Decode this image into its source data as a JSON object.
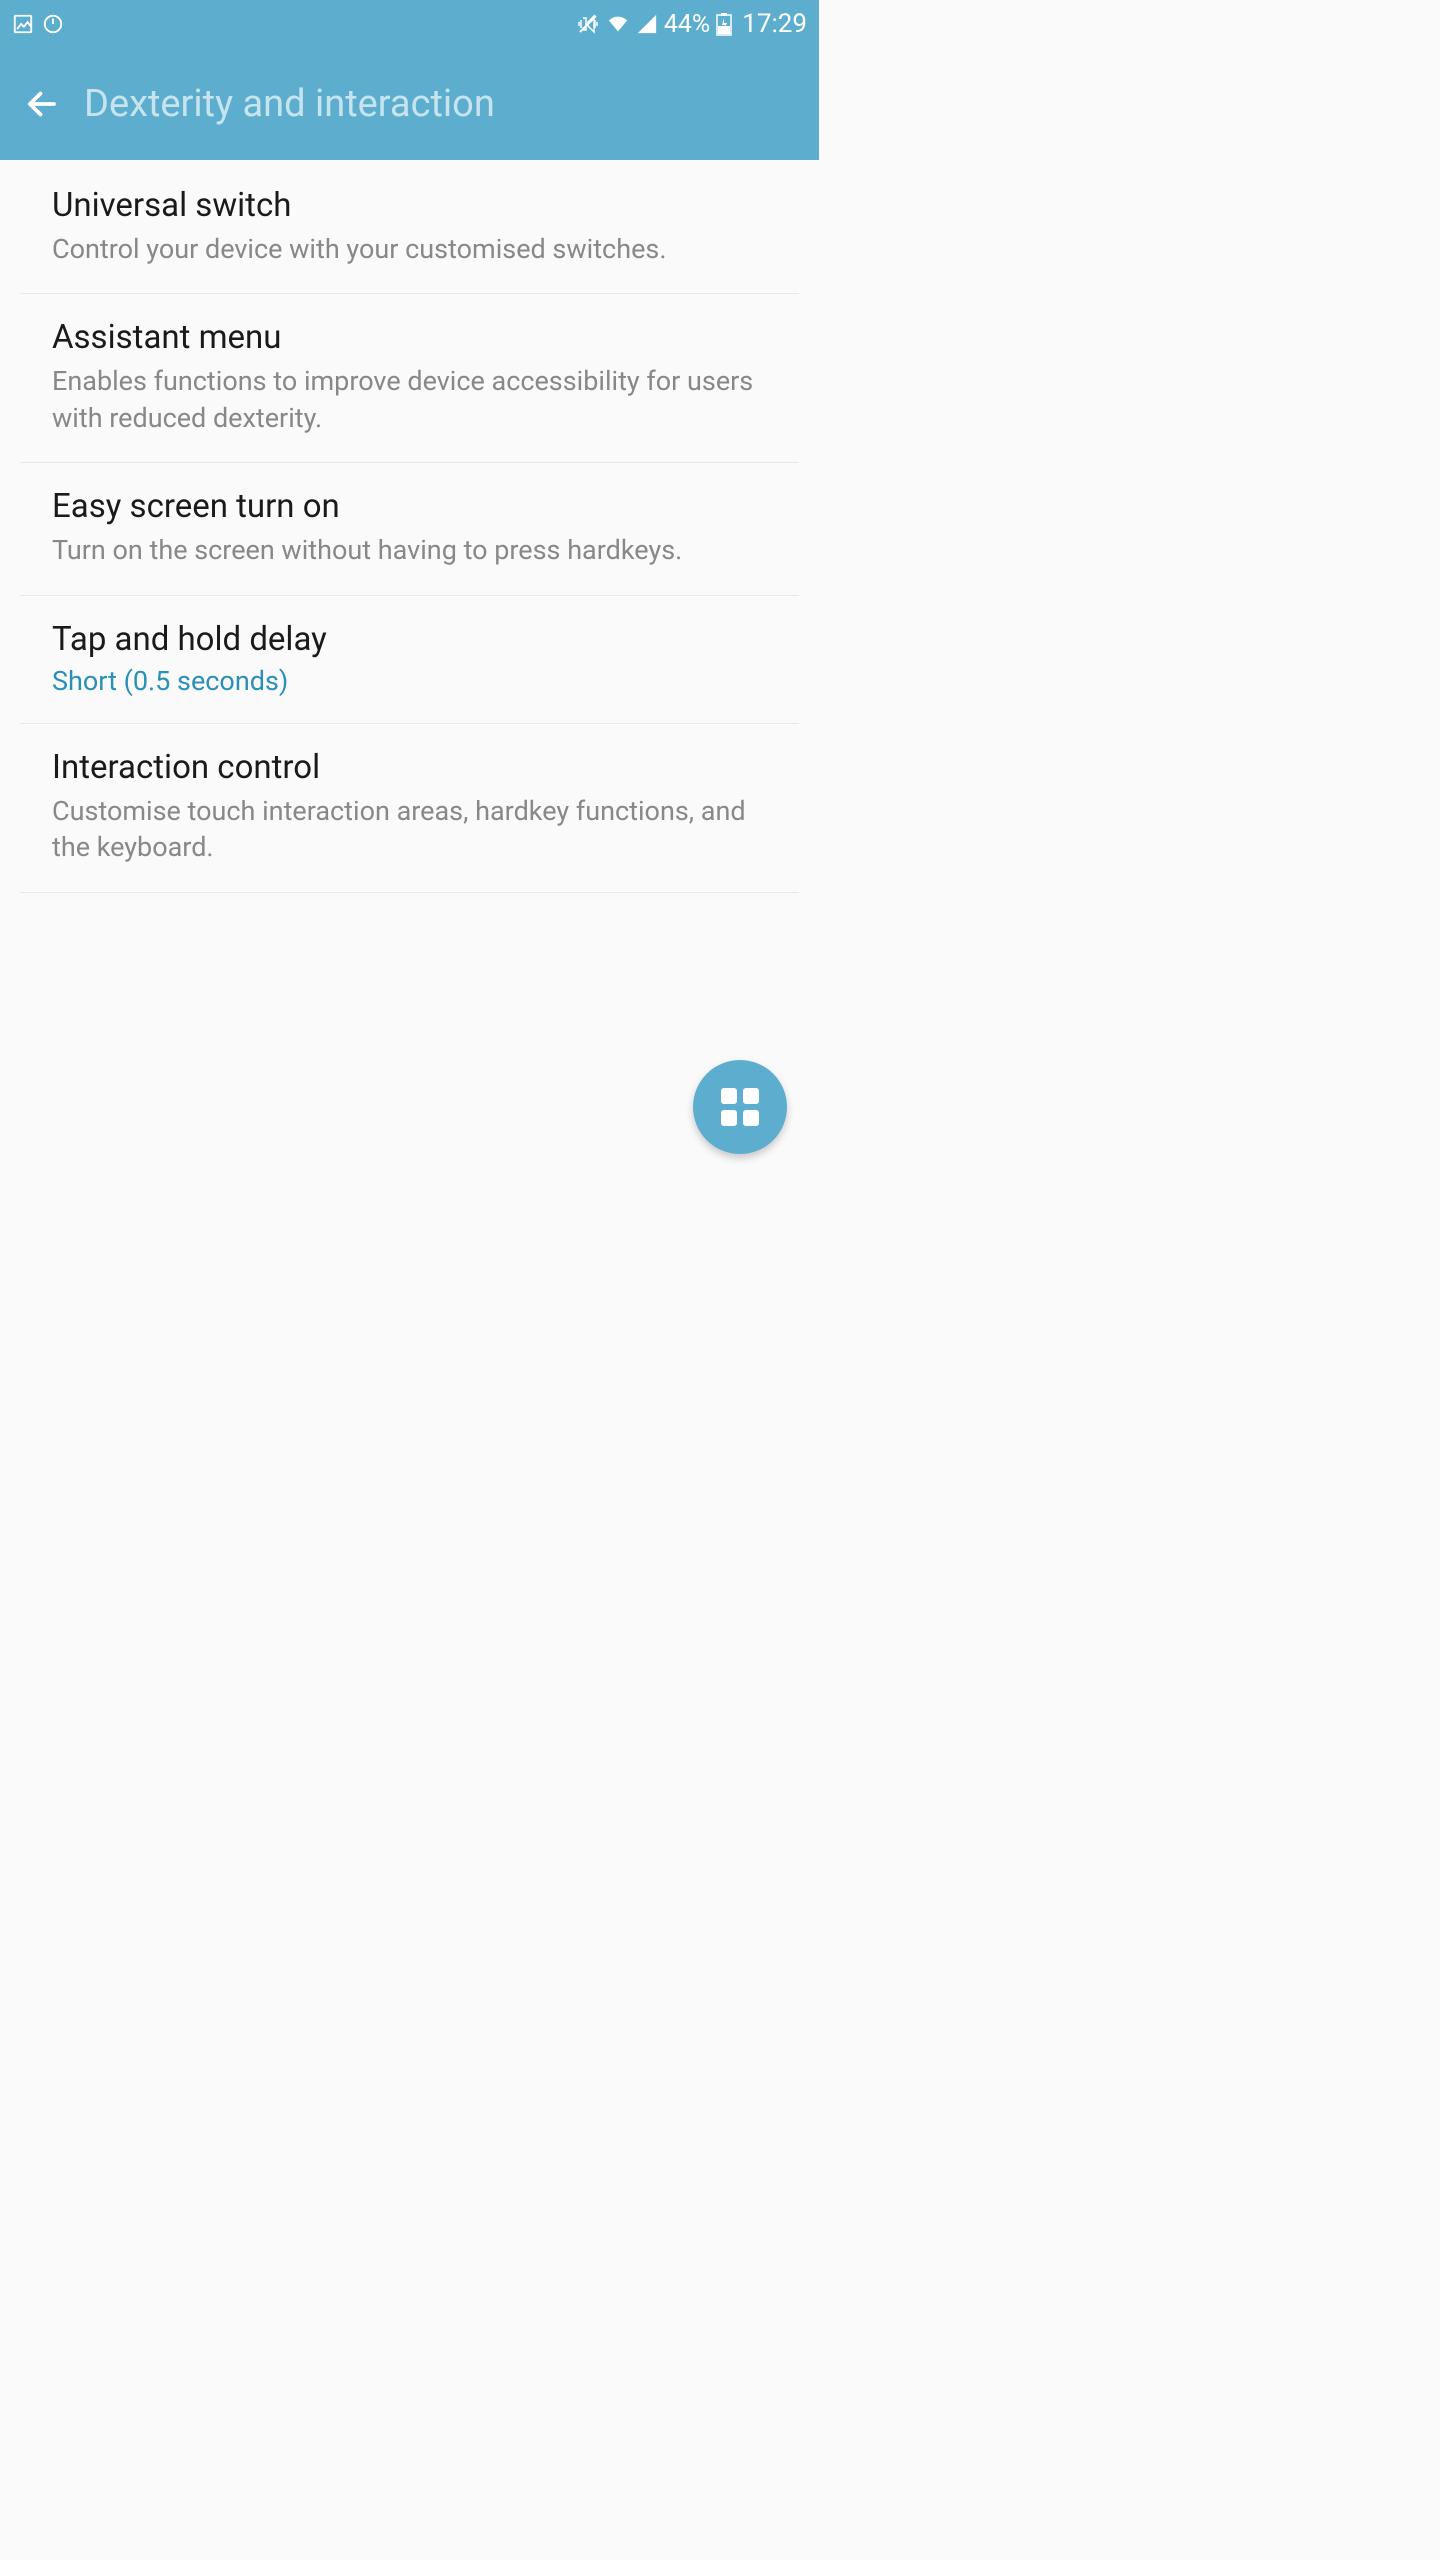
{
  "status_bar": {
    "battery_percent": "44%",
    "time": "17:29"
  },
  "header": {
    "title": "Dexterity and interaction"
  },
  "items": [
    {
      "title": "Universal switch",
      "subtitle": "Control your device with your customised switches."
    },
    {
      "title": "Assistant menu",
      "subtitle": "Enables functions to improve device accessibility for users with reduced dexterity."
    },
    {
      "title": "Easy screen turn on",
      "subtitle": "Turn on the screen without having to press hardkeys."
    },
    {
      "title": "Tap and hold delay",
      "value": "Short (0.5 seconds)"
    },
    {
      "title": "Interaction control",
      "subtitle": "Customise touch interaction areas, hardkey functions, and the keyboard."
    }
  ]
}
